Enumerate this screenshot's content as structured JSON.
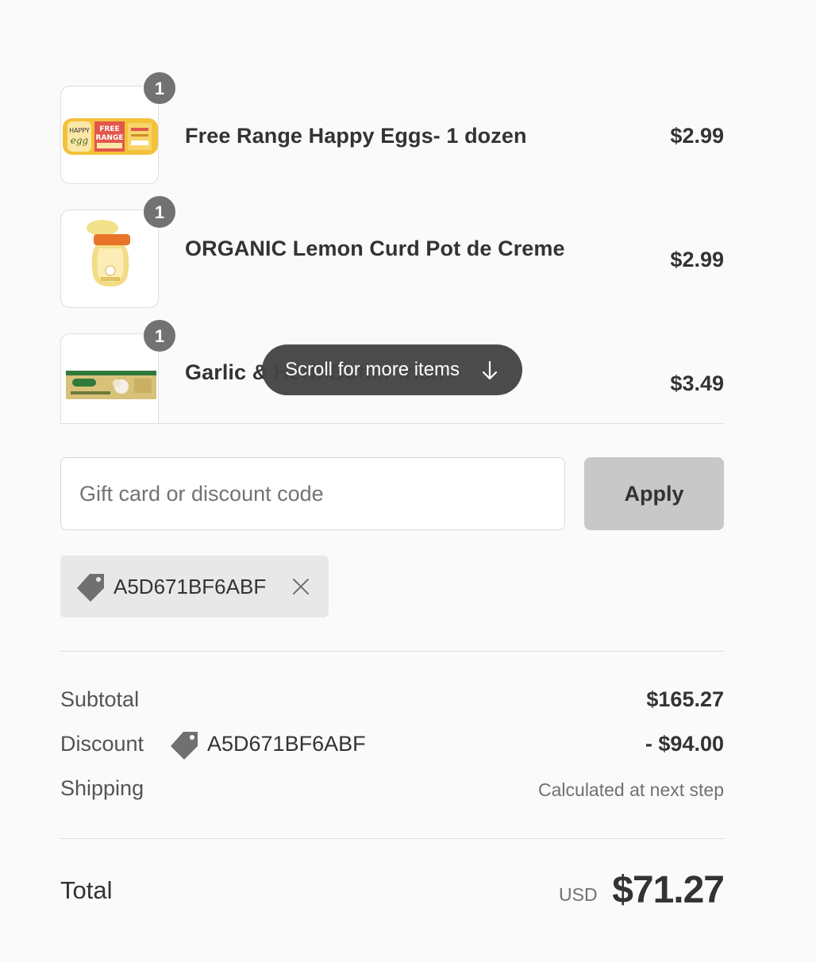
{
  "products": [
    {
      "quantity": "1",
      "name": "Free Range Happy Eggs- 1 dozen",
      "price": "$2.99",
      "thumbnail": "egg-carton-image"
    },
    {
      "quantity": "1",
      "name": "ORGANIC Lemon Curd Pot de Creme",
      "price": "$2.99",
      "thumbnail": "lemon-curd-jar-image"
    },
    {
      "quantity": "1",
      "name": "Garlic & Herb Butter Irish",
      "price": "$3.49",
      "thumbnail": "butter-box-image"
    }
  ],
  "scroll_hint": {
    "label": "Scroll for more items",
    "icon": "arrow-down-icon"
  },
  "discount": {
    "placeholder": "Gift card or discount code",
    "value": "",
    "apply_label": "Apply",
    "applied_code": "A5D671BF6ABF"
  },
  "totals": {
    "subtotal_label": "Subtotal",
    "subtotal_value": "$165.27",
    "discount_label": "Discount",
    "discount_code": "A5D671BF6ABF",
    "discount_value": "- $94.00",
    "shipping_label": "Shipping",
    "shipping_value": "Calculated at next step",
    "total_label": "Total",
    "currency": "USD",
    "total_value": "$71.27"
  },
  "colors": {
    "background": "#fafafa",
    "badge": "#727272",
    "apply_button": "#c8c8c8",
    "tag_background": "#e8e8e8"
  }
}
